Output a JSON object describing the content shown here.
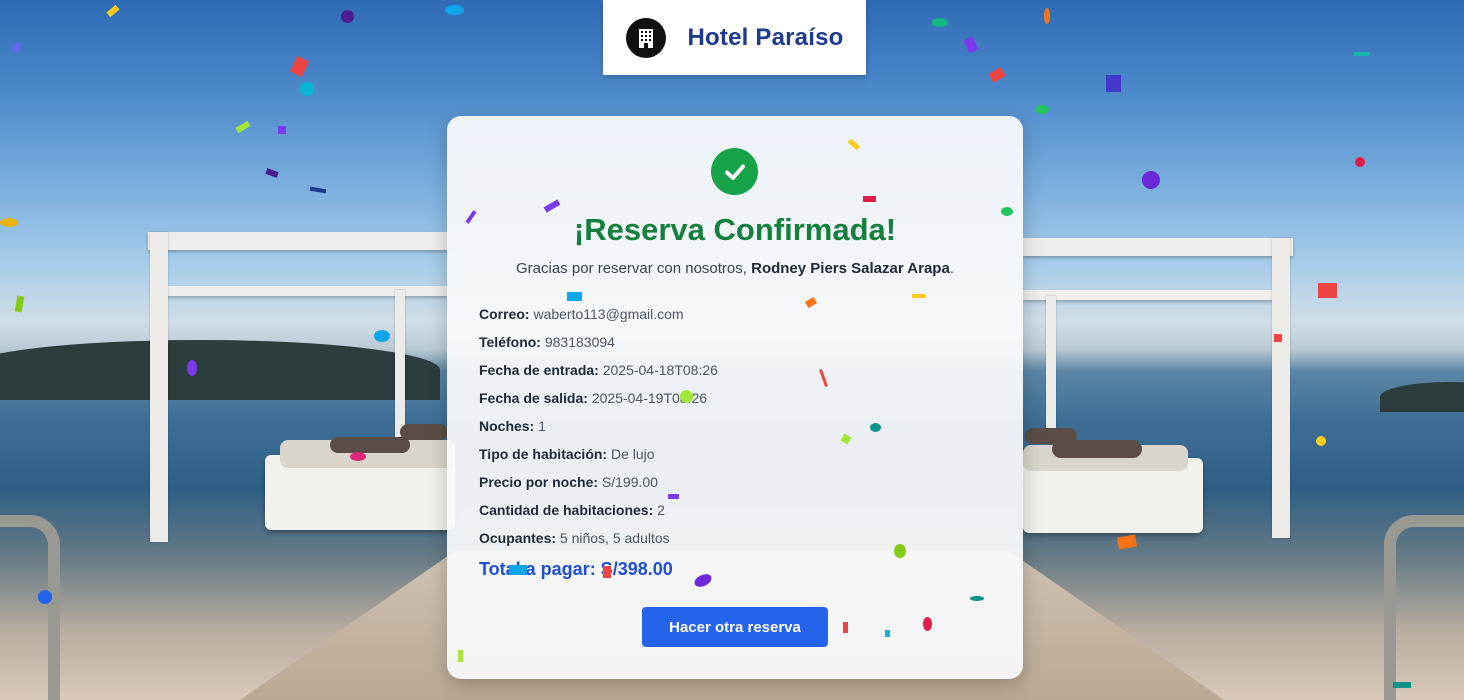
{
  "brand": {
    "name": "Hotel Paraíso",
    "icon": "hotel-building-icon"
  },
  "confirmation": {
    "icon": "check-circle-icon",
    "title": "¡Reserva Confirmada!",
    "thanks_prefix": "Gracias por reservar con nosotros,",
    "guest_name": "Rodney Piers Salazar Arapa",
    "thanks_suffix": "."
  },
  "details": [
    {
      "label": "Correo:",
      "value": "waberto113@gmail.com"
    },
    {
      "label": "Teléfono:",
      "value": "983183094"
    },
    {
      "label": "Fecha de entrada:",
      "value": "2025-04-18T08:26"
    },
    {
      "label": "Fecha de salida:",
      "value": "2025-04-19T08:26"
    },
    {
      "label": "Noches:",
      "value": "1"
    },
    {
      "label": "Tipo de habitación:",
      "value": "De lujo"
    },
    {
      "label": "Precio por noche:",
      "value": "S/199.00"
    },
    {
      "label": "Cantidad de habitaciones:",
      "value": "2"
    },
    {
      "label": "Ocupantes:",
      "value": "5 niños, 5 adultos"
    }
  ],
  "total": "Total a pagar: S/398.00",
  "actions": {
    "new_booking": "Hacer otra reserva"
  },
  "colors": {
    "brand_text": "#1e3a8a",
    "success": "#16a34a",
    "title_green": "#15803d",
    "total_blue": "#1d4ed8",
    "button": "#2563eb"
  }
}
